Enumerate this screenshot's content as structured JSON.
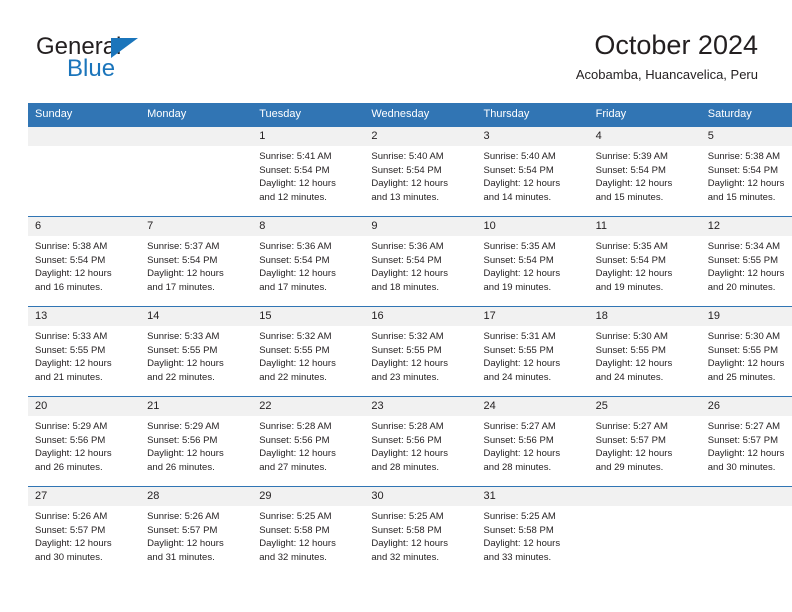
{
  "brand": {
    "name_part1": "General",
    "name_part2": "Blue",
    "accent_color": "#1b75bb"
  },
  "header": {
    "title": "October 2024",
    "subtitle": "Acobamba, Huancavelica, Peru",
    "header_bg_color": "#3175b4",
    "daynum_bg_color": "#f1f1f1"
  },
  "weekday_headers": [
    "Sunday",
    "Monday",
    "Tuesday",
    "Wednesday",
    "Thursday",
    "Friday",
    "Saturday"
  ],
  "weeks": [
    [
      {
        "day": "",
        "lines": []
      },
      {
        "day": "",
        "lines": []
      },
      {
        "day": "1",
        "lines": [
          "Sunrise: 5:41 AM",
          "Sunset: 5:54 PM",
          "Daylight: 12 hours",
          "and 12 minutes."
        ]
      },
      {
        "day": "2",
        "lines": [
          "Sunrise: 5:40 AM",
          "Sunset: 5:54 PM",
          "Daylight: 12 hours",
          "and 13 minutes."
        ]
      },
      {
        "day": "3",
        "lines": [
          "Sunrise: 5:40 AM",
          "Sunset: 5:54 PM",
          "Daylight: 12 hours",
          "and 14 minutes."
        ]
      },
      {
        "day": "4",
        "lines": [
          "Sunrise: 5:39 AM",
          "Sunset: 5:54 PM",
          "Daylight: 12 hours",
          "and 15 minutes."
        ]
      },
      {
        "day": "5",
        "lines": [
          "Sunrise: 5:38 AM",
          "Sunset: 5:54 PM",
          "Daylight: 12 hours",
          "and 15 minutes."
        ]
      }
    ],
    [
      {
        "day": "6",
        "lines": [
          "Sunrise: 5:38 AM",
          "Sunset: 5:54 PM",
          "Daylight: 12 hours",
          "and 16 minutes."
        ]
      },
      {
        "day": "7",
        "lines": [
          "Sunrise: 5:37 AM",
          "Sunset: 5:54 PM",
          "Daylight: 12 hours",
          "and 17 minutes."
        ]
      },
      {
        "day": "8",
        "lines": [
          "Sunrise: 5:36 AM",
          "Sunset: 5:54 PM",
          "Daylight: 12 hours",
          "and 17 minutes."
        ]
      },
      {
        "day": "9",
        "lines": [
          "Sunrise: 5:36 AM",
          "Sunset: 5:54 PM",
          "Daylight: 12 hours",
          "and 18 minutes."
        ]
      },
      {
        "day": "10",
        "lines": [
          "Sunrise: 5:35 AM",
          "Sunset: 5:54 PM",
          "Daylight: 12 hours",
          "and 19 minutes."
        ]
      },
      {
        "day": "11",
        "lines": [
          "Sunrise: 5:35 AM",
          "Sunset: 5:54 PM",
          "Daylight: 12 hours",
          "and 19 minutes."
        ]
      },
      {
        "day": "12",
        "lines": [
          "Sunrise: 5:34 AM",
          "Sunset: 5:55 PM",
          "Daylight: 12 hours",
          "and 20 minutes."
        ]
      }
    ],
    [
      {
        "day": "13",
        "lines": [
          "Sunrise: 5:33 AM",
          "Sunset: 5:55 PM",
          "Daylight: 12 hours",
          "and 21 minutes."
        ]
      },
      {
        "day": "14",
        "lines": [
          "Sunrise: 5:33 AM",
          "Sunset: 5:55 PM",
          "Daylight: 12 hours",
          "and 22 minutes."
        ]
      },
      {
        "day": "15",
        "lines": [
          "Sunrise: 5:32 AM",
          "Sunset: 5:55 PM",
          "Daylight: 12 hours",
          "and 22 minutes."
        ]
      },
      {
        "day": "16",
        "lines": [
          "Sunrise: 5:32 AM",
          "Sunset: 5:55 PM",
          "Daylight: 12 hours",
          "and 23 minutes."
        ]
      },
      {
        "day": "17",
        "lines": [
          "Sunrise: 5:31 AM",
          "Sunset: 5:55 PM",
          "Daylight: 12 hours",
          "and 24 minutes."
        ]
      },
      {
        "day": "18",
        "lines": [
          "Sunrise: 5:30 AM",
          "Sunset: 5:55 PM",
          "Daylight: 12 hours",
          "and 24 minutes."
        ]
      },
      {
        "day": "19",
        "lines": [
          "Sunrise: 5:30 AM",
          "Sunset: 5:55 PM",
          "Daylight: 12 hours",
          "and 25 minutes."
        ]
      }
    ],
    [
      {
        "day": "20",
        "lines": [
          "Sunrise: 5:29 AM",
          "Sunset: 5:56 PM",
          "Daylight: 12 hours",
          "and 26 minutes."
        ]
      },
      {
        "day": "21",
        "lines": [
          "Sunrise: 5:29 AM",
          "Sunset: 5:56 PM",
          "Daylight: 12 hours",
          "and 26 minutes."
        ]
      },
      {
        "day": "22",
        "lines": [
          "Sunrise: 5:28 AM",
          "Sunset: 5:56 PM",
          "Daylight: 12 hours",
          "and 27 minutes."
        ]
      },
      {
        "day": "23",
        "lines": [
          "Sunrise: 5:28 AM",
          "Sunset: 5:56 PM",
          "Daylight: 12 hours",
          "and 28 minutes."
        ]
      },
      {
        "day": "24",
        "lines": [
          "Sunrise: 5:27 AM",
          "Sunset: 5:56 PM",
          "Daylight: 12 hours",
          "and 28 minutes."
        ]
      },
      {
        "day": "25",
        "lines": [
          "Sunrise: 5:27 AM",
          "Sunset: 5:57 PM",
          "Daylight: 12 hours",
          "and 29 minutes."
        ]
      },
      {
        "day": "26",
        "lines": [
          "Sunrise: 5:27 AM",
          "Sunset: 5:57 PM",
          "Daylight: 12 hours",
          "and 30 minutes."
        ]
      }
    ],
    [
      {
        "day": "27",
        "lines": [
          "Sunrise: 5:26 AM",
          "Sunset: 5:57 PM",
          "Daylight: 12 hours",
          "and 30 minutes."
        ]
      },
      {
        "day": "28",
        "lines": [
          "Sunrise: 5:26 AM",
          "Sunset: 5:57 PM",
          "Daylight: 12 hours",
          "and 31 minutes."
        ]
      },
      {
        "day": "29",
        "lines": [
          "Sunrise: 5:25 AM",
          "Sunset: 5:58 PM",
          "Daylight: 12 hours",
          "and 32 minutes."
        ]
      },
      {
        "day": "30",
        "lines": [
          "Sunrise: 5:25 AM",
          "Sunset: 5:58 PM",
          "Daylight: 12 hours",
          "and 32 minutes."
        ]
      },
      {
        "day": "31",
        "lines": [
          "Sunrise: 5:25 AM",
          "Sunset: 5:58 PM",
          "Daylight: 12 hours",
          "and 33 minutes."
        ]
      },
      {
        "day": "",
        "lines": []
      },
      {
        "day": "",
        "lines": []
      }
    ]
  ]
}
